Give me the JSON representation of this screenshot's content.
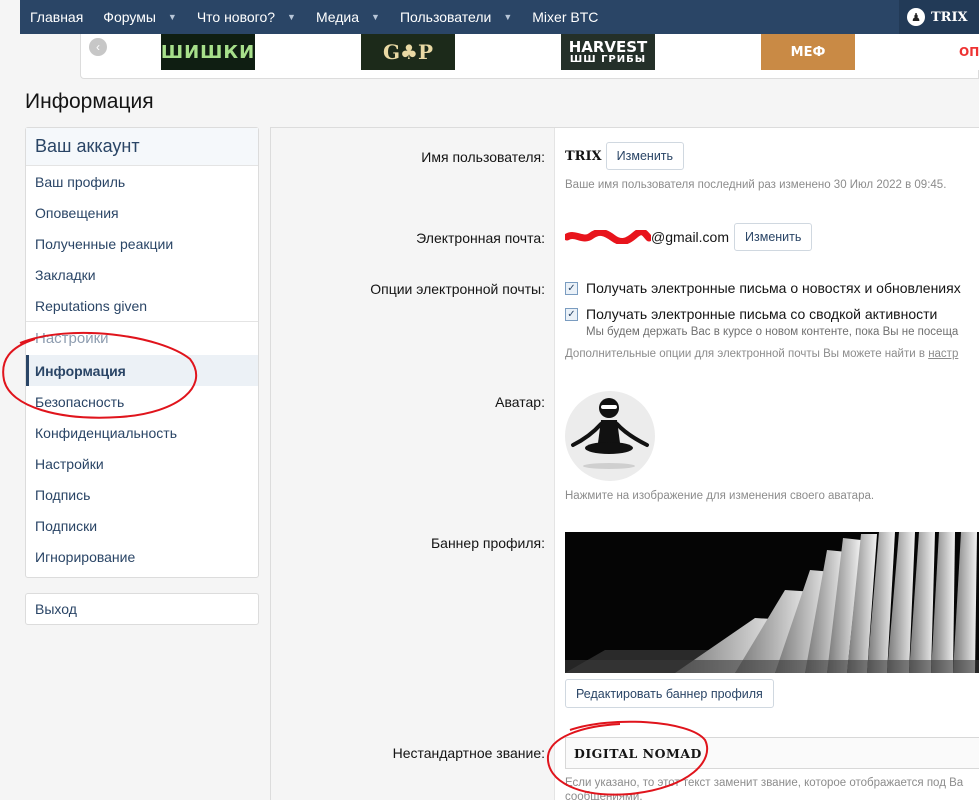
{
  "nav": {
    "items": [
      {
        "label": "Главная",
        "caret": false
      },
      {
        "label": "Форумы",
        "caret": true
      },
      {
        "label": "Что нового?",
        "caret": true
      },
      {
        "label": "Медиа",
        "caret": true
      },
      {
        "label": "Пользователи",
        "caret": true
      },
      {
        "label": "Mixer BTC",
        "caret": false
      }
    ],
    "user": "TRIX"
  },
  "ads": {
    "ad1": "ШИШКИ",
    "ad2": "G♣P",
    "ad3_line1": "HARVEST",
    "ad3_line2": "ШШ ГРИБЫ",
    "ad4": "МЕФ",
    "ad5": "ОП"
  },
  "page": {
    "title": "Информация"
  },
  "sidebar": {
    "head": "Ваш аккаунт",
    "items": [
      "Ваш профиль",
      "Оповещения",
      "Полученные реакции",
      "Закладки",
      "Reputations given"
    ],
    "settings_head": "Настройки",
    "settings_items": [
      "Информация",
      "Безопасность",
      "Конфиденциальность",
      "Настройки",
      "Подпись",
      "Подписки",
      "Игнорирование"
    ],
    "logout": "Выход"
  },
  "form": {
    "username_label": "Имя пользователя:",
    "username": "TRIX",
    "change_label": "Изменить",
    "username_hint": "Ваше имя пользователя последний раз изменено 30 Июл 2022 в 09:45.",
    "email_label": "Электронная почта:",
    "email_domain": "@gmail.com",
    "email_options_label": "Опции электронной почты:",
    "option1": "Получать электронные письма о новостях и обновлениях",
    "option2": "Получать электронные письма со сводкой активности",
    "option2_hint": "Мы будем держать Вас в курсе о новом контенте, пока Вы не посеща",
    "options_hint": "Дополнительные опции для электронной почты Вы можете найти в",
    "options_hint_link": "настр",
    "avatar_label": "Аватар:",
    "avatar_hint": "Нажмите на изображение для изменения своего аватара.",
    "banner_label": "Баннер профиля:",
    "banner_button": "Редактировать баннер профиля",
    "title_label": "Нестандартное звание:",
    "title_value": "DIGITAL NOMAD",
    "title_hint": "Если указано, то этот текст заменит звание, которое отображается под Ва",
    "title_hint2": "сообщениями."
  }
}
